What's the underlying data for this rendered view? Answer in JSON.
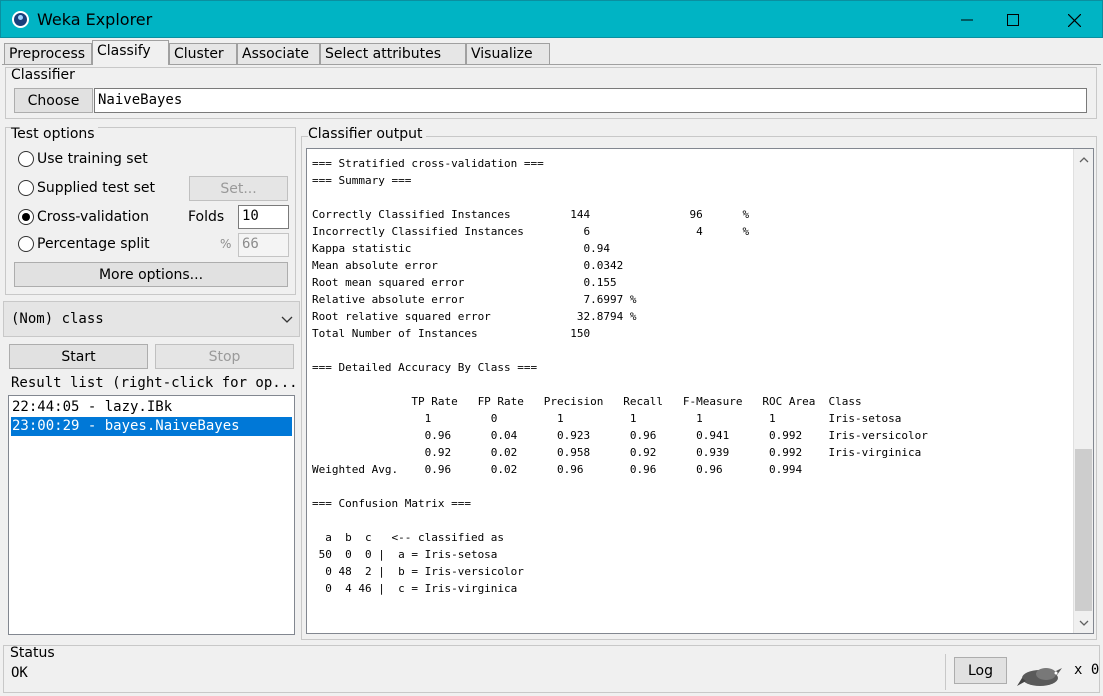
{
  "window": {
    "title": "Weka Explorer",
    "minimize": "—",
    "maximize": "☐",
    "close": "✕"
  },
  "tabs": [
    {
      "label": "Preprocess"
    },
    {
      "label": "Classify"
    },
    {
      "label": "Cluster"
    },
    {
      "label": "Associate"
    },
    {
      "label": "Select attributes"
    },
    {
      "label": "Visualize"
    }
  ],
  "classifier": {
    "section_label": "Classifier",
    "choose_label": "Choose",
    "value": "NaiveBayes"
  },
  "test_options": {
    "section_label": "Test options",
    "use_training_set": "Use training set",
    "supplied_test_set": "Supplied test set",
    "set_button": "Set...",
    "cross_validation": "Cross-validation",
    "folds_label": "Folds",
    "folds_value": "10",
    "percentage_split": "Percentage split",
    "percent_sign": "%",
    "percent_value": "66",
    "more_options": "More options...",
    "selected": "cross_validation"
  },
  "class_select": {
    "value": "(Nom) class"
  },
  "run": {
    "start": "Start",
    "stop": "Stop"
  },
  "result_list": {
    "label": "Result list (right-click for op...",
    "items": [
      {
        "text": "22:44:05 - lazy.IBk",
        "selected": false
      },
      {
        "text": "23:00:29 - bayes.NaiveBayes",
        "selected": true
      }
    ]
  },
  "output": {
    "label": "Classifier output",
    "text": "=== Stratified cross-validation ===\n=== Summary ===\n\nCorrectly Classified Instances         144               96      %\nIncorrectly Classified Instances         6                4      %\nKappa statistic                          0.94\nMean absolute error                      0.0342\nRoot mean squared error                  0.155\nRelative absolute error                  7.6997 %\nRoot relative squared error             32.8794 %\nTotal Number of Instances              150\n\n=== Detailed Accuracy By Class ===\n\n               TP Rate   FP Rate   Precision   Recall   F-Measure   ROC Area  Class\n                 1         0         1          1         1          1        Iris-setosa\n                 0.96      0.04      0.923      0.96      0.941      0.992    Iris-versicolor\n                 0.92      0.02      0.958      0.92      0.939      0.992    Iris-virginica\nWeighted Avg.    0.96      0.02      0.96       0.96      0.96       0.994\n\n=== Confusion Matrix ===\n\n  a  b  c   <-- classified as\n 50  0  0 |  a = Iris-setosa\n  0 48  2 |  b = Iris-versicolor\n  0  4 46 |  c = Iris-virginica"
  },
  "status": {
    "label": "Status",
    "value": "OK",
    "log_button": "Log",
    "count": "x 0"
  }
}
